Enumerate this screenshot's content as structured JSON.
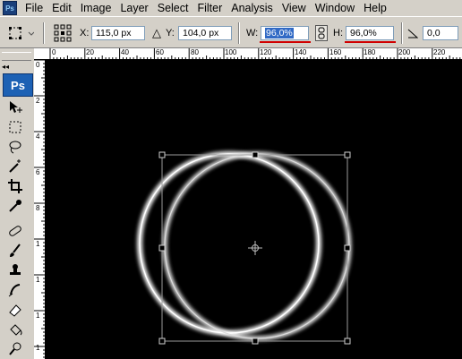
{
  "app": {
    "icon_label": "Ps"
  },
  "menu": [
    "File",
    "Edit",
    "Image",
    "Layer",
    "Select",
    "Filter",
    "Analysis",
    "View",
    "Window",
    "Help"
  ],
  "options": {
    "x_label": "X:",
    "x_value": "115,0 px",
    "y_label": "Y:",
    "y_value": "104,0 px",
    "w_label": "W:",
    "w_value": "96,0%",
    "h_label": "H:",
    "h_value": "96,0%",
    "angle_value": "0,0"
  },
  "rulers": {
    "top": [
      "0",
      "20",
      "40",
      "60",
      "80",
      "100",
      "120",
      "140",
      "160",
      "180",
      "200",
      "220"
    ],
    "left": [
      "0",
      "2",
      "4",
      "6",
      "8",
      "1",
      "1",
      "1",
      "1"
    ]
  },
  "toolbox": {
    "logo": "Ps"
  },
  "colors": {
    "highlight": "#316ac5",
    "annotation": "#d00000",
    "panel": "#d4d0c8"
  }
}
